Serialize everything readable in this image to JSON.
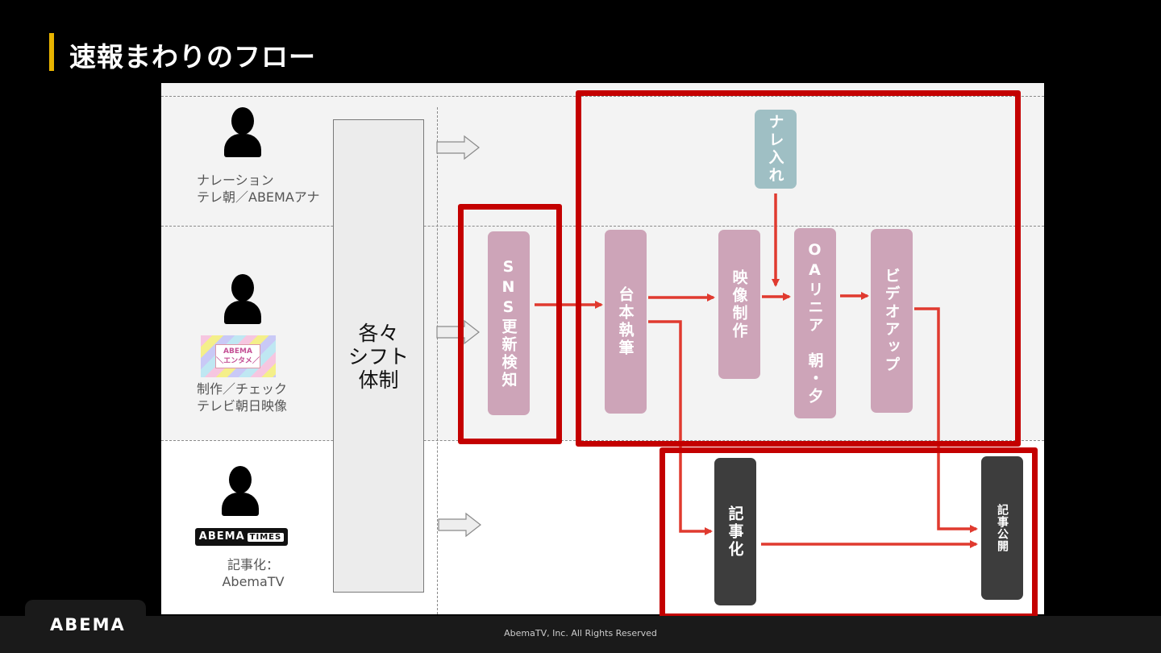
{
  "slide": {
    "title": "速報まわりのフロー",
    "colors": {
      "accent": "#e8b400",
      "highlight": "#c40000",
      "arrow": "#e03a2f",
      "pink_box": "#cda4b8",
      "teal_box": "#9fbfc4",
      "dark_box": "#3d3d3d"
    }
  },
  "lanes": [
    {
      "role_line1": "ナレーション",
      "role_line2": "テレ朝／ABEMAアナ",
      "icon": "person-icon"
    },
    {
      "role_line1": "制作／チェック",
      "role_line2": "テレビ朝日映像",
      "icon": "person-icon",
      "logo": "ABEMA エンタメ",
      "logo_line1": "ABEMA",
      "logo_line2": "＼エンタメ／"
    },
    {
      "role_line1": "記事化：",
      "role_line2": "AbemaTV",
      "icon": "person-icon",
      "logo": "ABEMA TIMES",
      "logo_line1": "ABEMA",
      "logo_line2": "TIMES"
    }
  ],
  "shift": {
    "label_line1": "各々",
    "label_line2": "シフト",
    "label_line3": "体制"
  },
  "steps": {
    "sns": "SNS更新検知",
    "narration": "ナレ入れ",
    "script": "台本執筆",
    "video": "映像制作",
    "oa": "OAリニア　朝・夕",
    "upload": "ビデオアップ",
    "article": "記事化",
    "publish": "記事公開"
  },
  "footer": {
    "logo": "ABEMA",
    "copyright": "AbemaTV, Inc. All Rights Reserved"
  }
}
